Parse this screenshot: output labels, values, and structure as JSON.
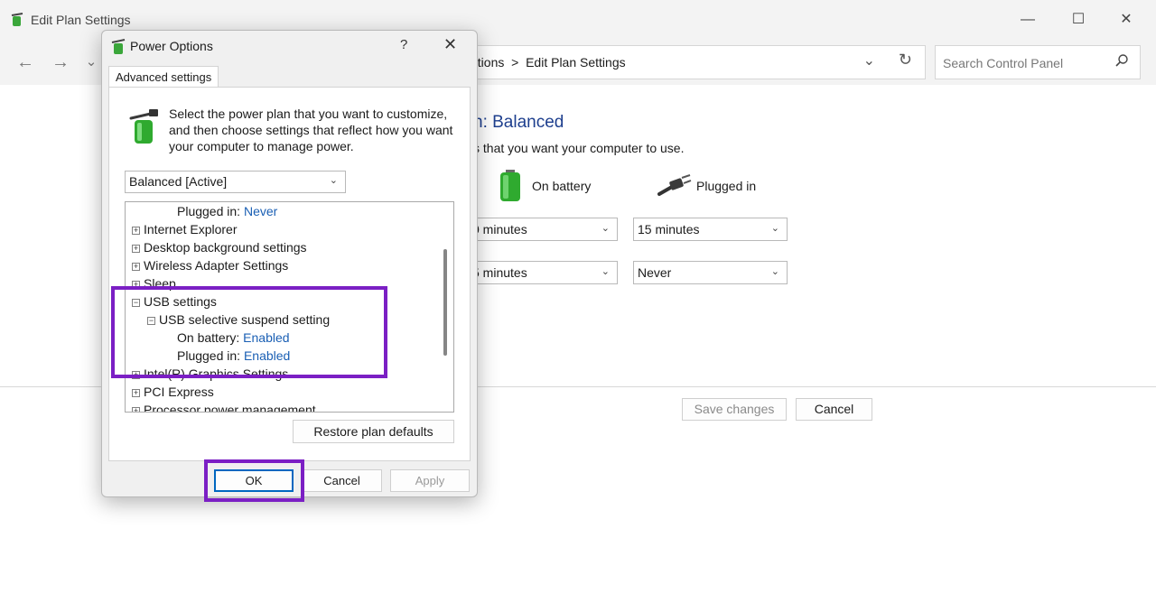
{
  "window": {
    "title": "Edit Plan Settings",
    "controls": {
      "minimize": "—",
      "maximize": "☐",
      "close": "✕"
    },
    "nav": {
      "back": "←",
      "forward": "→",
      "recent": "⌄"
    },
    "address": {
      "crumb": "ptions  >  Edit Plan Settings"
    },
    "search": {
      "placeholder": "Search Control Panel"
    }
  },
  "plan_page": {
    "title": "n: Balanced",
    "subtitle": "s that you want your computer to use.",
    "col_battery": "On battery",
    "col_plugged": "Plugged in",
    "rows": [
      {
        "battery": "0 minutes",
        "plugged": "15 minutes"
      },
      {
        "battery": "5 minutes",
        "plugged": "Never"
      }
    ],
    "save_button": "Save changes",
    "cancel_button": "Cancel"
  },
  "dialog": {
    "title": "Power Options",
    "help": "?",
    "close": "✕",
    "tab": "Advanced settings",
    "intro": "Select the power plan that you want to customize, and then choose settings that reflect how you want your computer to manage power.",
    "plan_select": "Balanced [Active]",
    "tree": [
      {
        "prefix": "",
        "label": "Plugged in: ",
        "value": "Never"
      },
      {
        "prefix": "+",
        "label": "Internet Explorer",
        "value": ""
      },
      {
        "prefix": "+",
        "label": "Desktop background settings",
        "value": ""
      },
      {
        "prefix": "+",
        "label": "Wireless Adapter Settings",
        "value": ""
      },
      {
        "prefix": "+",
        "label": "Sleep",
        "value": ""
      },
      {
        "prefix": "−",
        "label": "USB settings",
        "value": ""
      },
      {
        "prefix": "−",
        "label": "USB selective suspend setting",
        "value": ""
      },
      {
        "prefix": "",
        "label": "On battery: ",
        "value": "Enabled"
      },
      {
        "prefix": "",
        "label": "Plugged in: ",
        "value": "Enabled"
      },
      {
        "prefix": "+",
        "label": "Intel(R) Graphics Settings",
        "value": ""
      },
      {
        "prefix": "+",
        "label": "PCI Express",
        "value": ""
      },
      {
        "prefix": "+",
        "label": "Processor power management",
        "value": ""
      }
    ],
    "restore_button": "Restore plan defaults",
    "ok_button": "OK",
    "cancel_button": "Cancel",
    "apply_button": "Apply"
  },
  "colors": {
    "highlight": "#7b1fc4",
    "accent": "#0067c0",
    "link": "#1a5fb4"
  }
}
